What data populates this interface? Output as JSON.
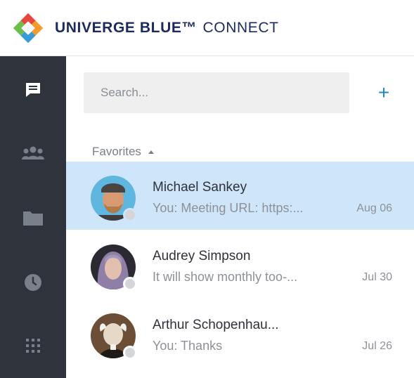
{
  "brand": {
    "name_bold": "UNIVERGE BLUE™",
    "name_light": "CONNECT",
    "logo_colors": [
      "#3a9ad9",
      "#6cbf4a",
      "#e8463c",
      "#f39a2b"
    ]
  },
  "sidebar": {
    "items": [
      {
        "icon": "chat-icon",
        "active": true
      },
      {
        "icon": "contacts-icon",
        "active": false
      },
      {
        "icon": "folder-icon",
        "active": false
      },
      {
        "icon": "clock-icon",
        "active": false
      },
      {
        "icon": "apps-grid-icon",
        "active": false
      }
    ]
  },
  "search": {
    "placeholder": "Search..."
  },
  "add_button": {
    "label": "+"
  },
  "favorites": {
    "label": "Favorites",
    "conversations": [
      {
        "name": "Michael Sankey",
        "preview": "You: Meeting URL: https:...",
        "date": "Aug 06",
        "selected": true
      },
      {
        "name": "Audrey Simpson",
        "preview": "It will show monthly too-...",
        "date": "Jul 30",
        "selected": false
      },
      {
        "name": "Arthur Schopenhau...",
        "preview": "You: Thanks",
        "date": "Jul 26",
        "selected": false
      }
    ]
  },
  "colors": {
    "sidebar_bg": "#2f343c",
    "selected_row": "#cfe6fa",
    "accent": "#1f87cc",
    "brand_text": "#1d2b5c"
  }
}
